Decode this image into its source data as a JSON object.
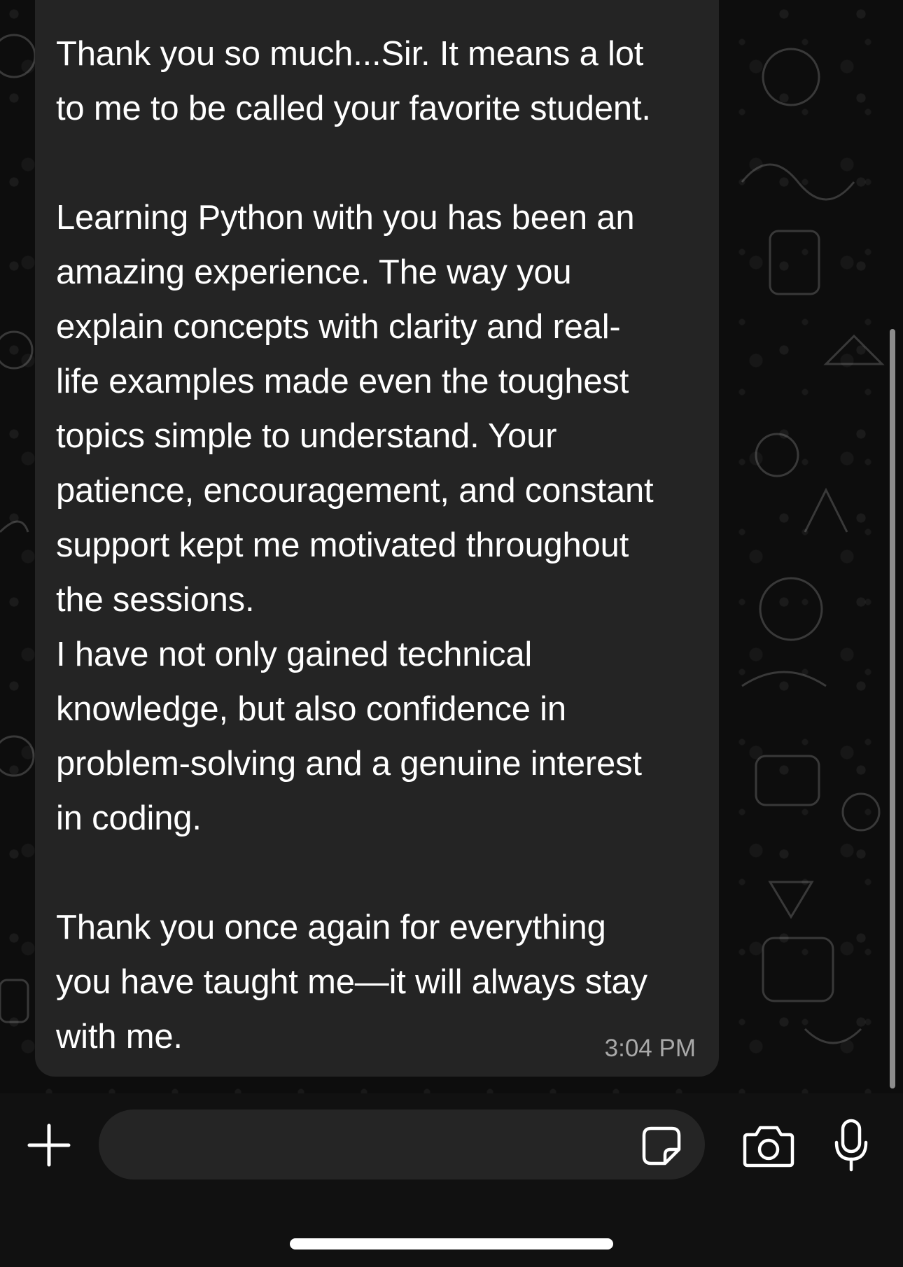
{
  "message": {
    "text": "Thank you so much...Sir. It means a lot\nto me to be called your favorite student.\n\nLearning Python with you has been an\namazing experience. The way you\nexplain concepts with clarity and real-\nlife examples made even the toughest\ntopics simple to understand. Your\npatience, encouragement, and constant\nsupport kept me motivated throughout\nthe sessions.\nI have not only gained technical\nknowledge, but also confidence in\nproblem-solving and a genuine interest\nin coding.\n\nThank you once again for everything\nyou have taught me—it will always stay\nwith me.",
    "time": "3:04 PM"
  },
  "composer": {
    "value": "",
    "icons": [
      "plus-icon",
      "sticker-icon",
      "camera-icon",
      "microphone-icon"
    ]
  },
  "colors": {
    "background": "#0d0d0d",
    "bubble": "#242424",
    "text": "#ffffff",
    "timestamp": "#a9a9a9",
    "input_field": "#252525"
  }
}
